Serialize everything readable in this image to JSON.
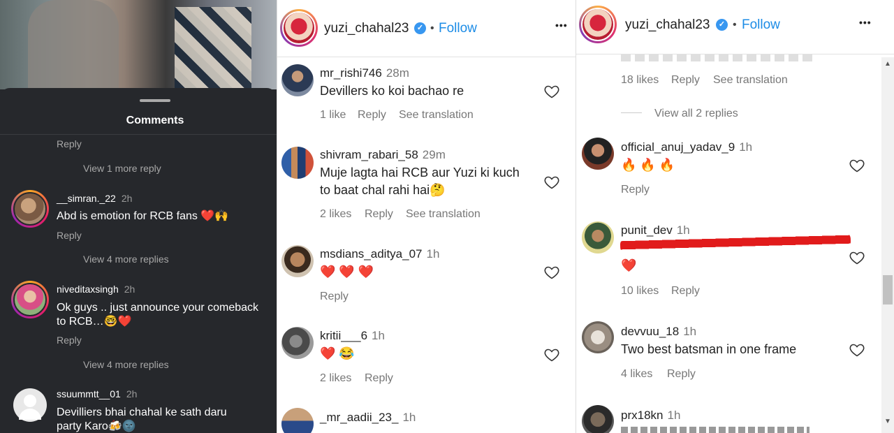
{
  "panel1": {
    "title": "Comments",
    "top_reply": "Reply",
    "top_more": "View 1 more reply",
    "comments": [
      {
        "user": "__simran._22",
        "time": "2h",
        "text": "Abd is emotion for RCB fans ❤️🙌",
        "reply": "Reply",
        "more": "View 4 more replies"
      },
      {
        "user": "niveditaxsingh",
        "time": "2h",
        "text": "Ok guys .. just announce your comeback to RCB…🤓❤️",
        "reply": "Reply",
        "more": "View 4 more replies"
      },
      {
        "user": "ssuummtt__01",
        "time": "2h",
        "text": "Devilliers bhai chahal ke sath daru party Karo🍻🌚"
      }
    ]
  },
  "panel2": {
    "header": {
      "username": "yuzi_chahal23",
      "verified": "✓",
      "dot": "•",
      "follow": "Follow",
      "more": "•••"
    },
    "comments": [
      {
        "user": "mr_rishi746",
        "time": "28m",
        "text": "Devillers ko koi bachao re",
        "likes": "1 like",
        "reply": "Reply",
        "translate": "See translation"
      },
      {
        "user": "shivram_rabari_58",
        "time": "29m",
        "text1": "Muje lagta hai RCB aur Yuzi ki kuch",
        "text2": "to baat chal rahi hai🤔",
        "likes": "2 likes",
        "reply": "Reply",
        "translate": "See translation"
      },
      {
        "user": "msdians_aditya_07",
        "time": "1h",
        "text": "❤️ ❤️ ❤️",
        "reply": "Reply"
      },
      {
        "user": "kritii___6",
        "time": "1h",
        "text": "❤️ 😂",
        "likes": "2 likes",
        "reply": "Reply"
      },
      {
        "user": "_mr_aadii_23_",
        "time": "1h"
      }
    ]
  },
  "panel3": {
    "header": {
      "username": "yuzi_chahal23",
      "verified": "✓",
      "dot": "•",
      "follow": "Follow",
      "more": "•••"
    },
    "top": {
      "likes": "18 likes",
      "reply": "Reply",
      "translate": "See translation",
      "view_replies": "View all 2 replies"
    },
    "comments": [
      {
        "user": "official_anuj_yadav_9",
        "time": "1h",
        "text": "🔥 🔥 🔥",
        "reply": "Reply"
      },
      {
        "user": "punit_dev",
        "time": "1h",
        "text": "❤️",
        "likes": "10 likes",
        "reply": "Reply"
      },
      {
        "user": "devvuu_18",
        "time": "1h",
        "text": "Two best batsman in one frame",
        "likes": "4 likes",
        "reply": "Reply"
      },
      {
        "user": "prx18kn",
        "time": "1h"
      }
    ]
  },
  "colors": {
    "dark_bg": "#26282c",
    "follow_blue": "#1c8ce6",
    "verified_blue": "#3897f0",
    "scribble_red": "#e11b1b"
  }
}
